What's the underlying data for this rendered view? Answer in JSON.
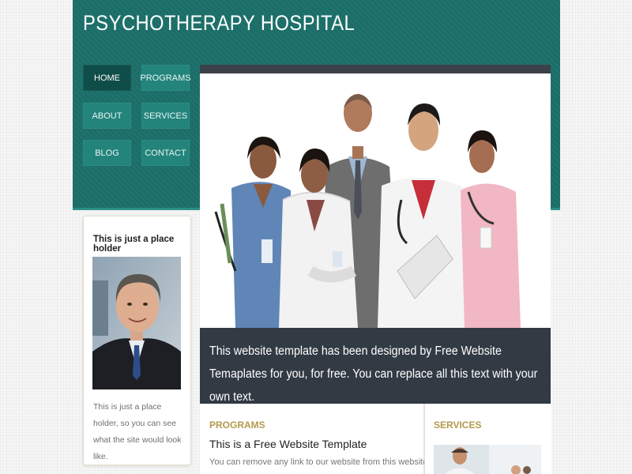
{
  "site": {
    "title": "PSYCHOTHERAPY HOSPITAL"
  },
  "nav": [
    {
      "label": "HOME",
      "active": true
    },
    {
      "label": "PROGRAMS"
    },
    {
      "label": "ABOUT"
    },
    {
      "label": "SERVICES"
    },
    {
      "label": "BLOG"
    },
    {
      "label": "CONTACT"
    }
  ],
  "hero": {
    "caption": "This website template has been designed by Free Website Temaplates for you, for free. You can replace all this text with your own text."
  },
  "sidebar": {
    "title": "This is just a place holder",
    "text": "This is just a place holder, so you can see what the site would look like."
  },
  "programs": {
    "label": "PROGRAMS",
    "title": "This is a Free Website Template",
    "text": "You can remove any link to our website from this website template,"
  },
  "services": {
    "label": "SERVICES"
  },
  "colors": {
    "header_bg": "#1b6e68",
    "nav_button": "#23847c",
    "nav_active": "#0f4d49",
    "caption_bg": "#323a44",
    "section_label": "#b39a4d"
  }
}
